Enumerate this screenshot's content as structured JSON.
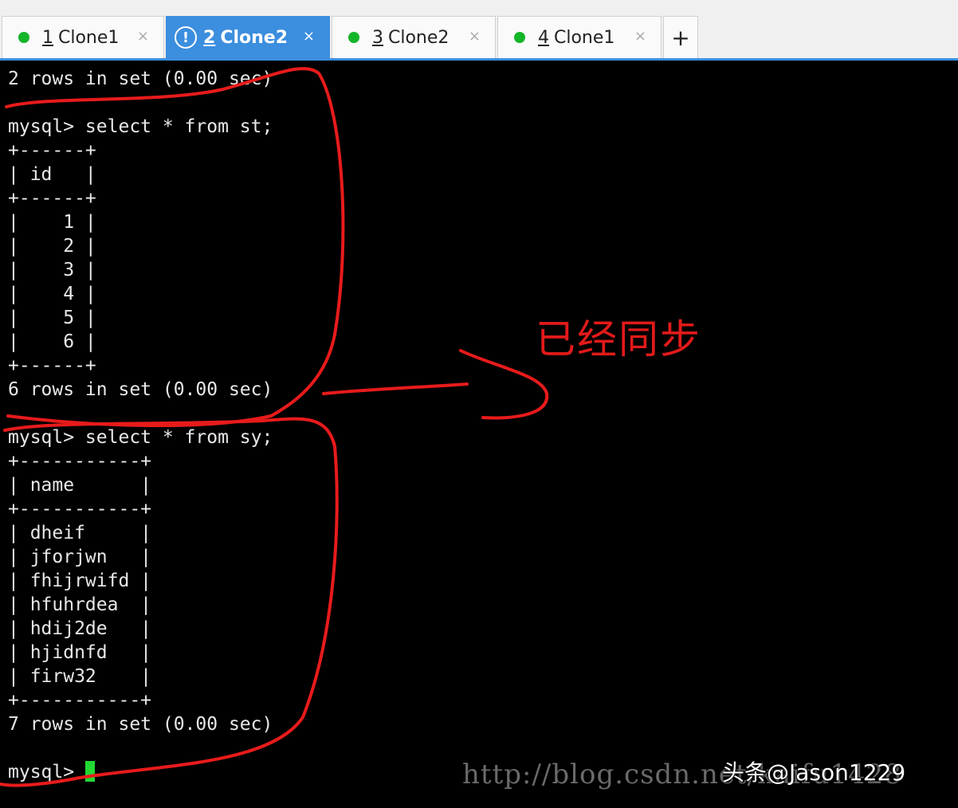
{
  "tabs": [
    {
      "number": "1",
      "title": "Clone1",
      "close": "×"
    },
    {
      "number": "2",
      "title": "Clone2",
      "close": "×",
      "alert": "!"
    },
    {
      "number": "3",
      "title": "Clone2",
      "close": "×"
    },
    {
      "number": "4",
      "title": "Clone1",
      "close": "×"
    }
  ],
  "new_tab_label": "+",
  "terminal": {
    "lines": [
      "2 rows in set (0.00 sec)",
      "",
      "mysql> select * from st;",
      "+------+",
      "| id   |",
      "+------+",
      "|    1 |",
      "|    2 |",
      "|    3 |",
      "|    4 |",
      "|    5 |",
      "|    6 |",
      "+------+",
      "6 rows in set (0.00 sec)",
      "",
      "mysql> select * from sy;",
      "+-----------+",
      "| name      |",
      "+-----------+",
      "| dheif     |",
      "| jforjwn   |",
      "| fhijrwifd |",
      "| hfuhrdea  |",
      "| hdij2de   |",
      "| hjidnfd   |",
      "| firw32    |",
      "+-----------+",
      "7 rows in set (0.00 sec)",
      ""
    ],
    "prompt": "mysql> "
  },
  "annotation": {
    "text": "已经同步",
    "color": "#e21a1a"
  },
  "watermark": {
    "url": "http://blog.csdn.net/kaifu1428",
    "author": "头条@Jason1229"
  },
  "colors": {
    "tab_active": "#3c8ede",
    "status_dot": "#15b52a",
    "cursor": "#22d833"
  }
}
